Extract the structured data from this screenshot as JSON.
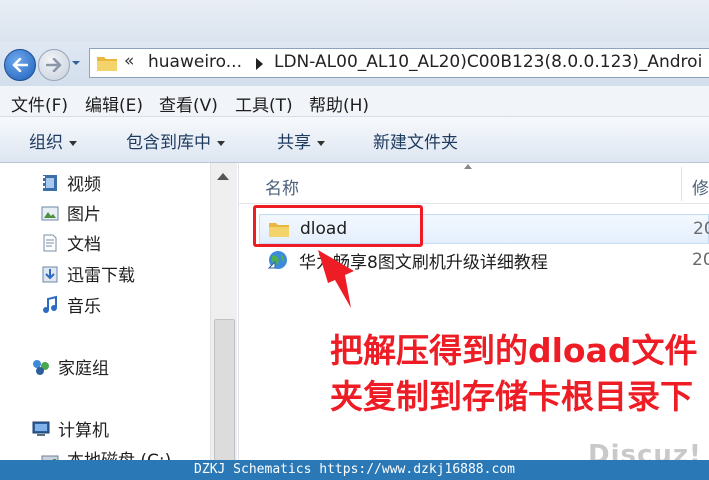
{
  "address": {
    "overflow": "«",
    "segment1": "huaweiro...",
    "segment2": "LDN-AL00_AL10_AL20)C00B123(8.0.0.123)_Androi"
  },
  "menu": [
    "文件(F)",
    "编辑(E)",
    "查看(V)",
    "工具(T)",
    "帮助(H)"
  ],
  "toolbar": {
    "organize": "组织",
    "include_library": "包含到库中",
    "share": "共享",
    "new_folder": "新建文件夹"
  },
  "nav": {
    "videos": "视频",
    "pictures": "图片",
    "documents": "文档",
    "thunder": "迅雷下载",
    "music": "音乐",
    "homegroup": "家庭组",
    "computer": "计算机",
    "local_disk": "本地磁盘 (C:)"
  },
  "columns": {
    "name": "名称",
    "modified": "修"
  },
  "files": [
    {
      "name": "dload",
      "date": "20",
      "icon": "folder-icon"
    },
    {
      "name": "华为畅享8图文刷机升级详细教程",
      "date": "20",
      "icon": "web-shortcut-icon"
    }
  ],
  "annotation": {
    "text": "把解压得到的dload文件夹复制到存储卡根目录下",
    "color": "#ee1c24"
  },
  "watermark": "Discuz!",
  "banner": "DZKJ Schematics https://www.dzkj16888.com",
  "colors": {
    "banner": "#2a78b6",
    "annotation": "#ee1c24",
    "folder": "#f2c94c"
  }
}
